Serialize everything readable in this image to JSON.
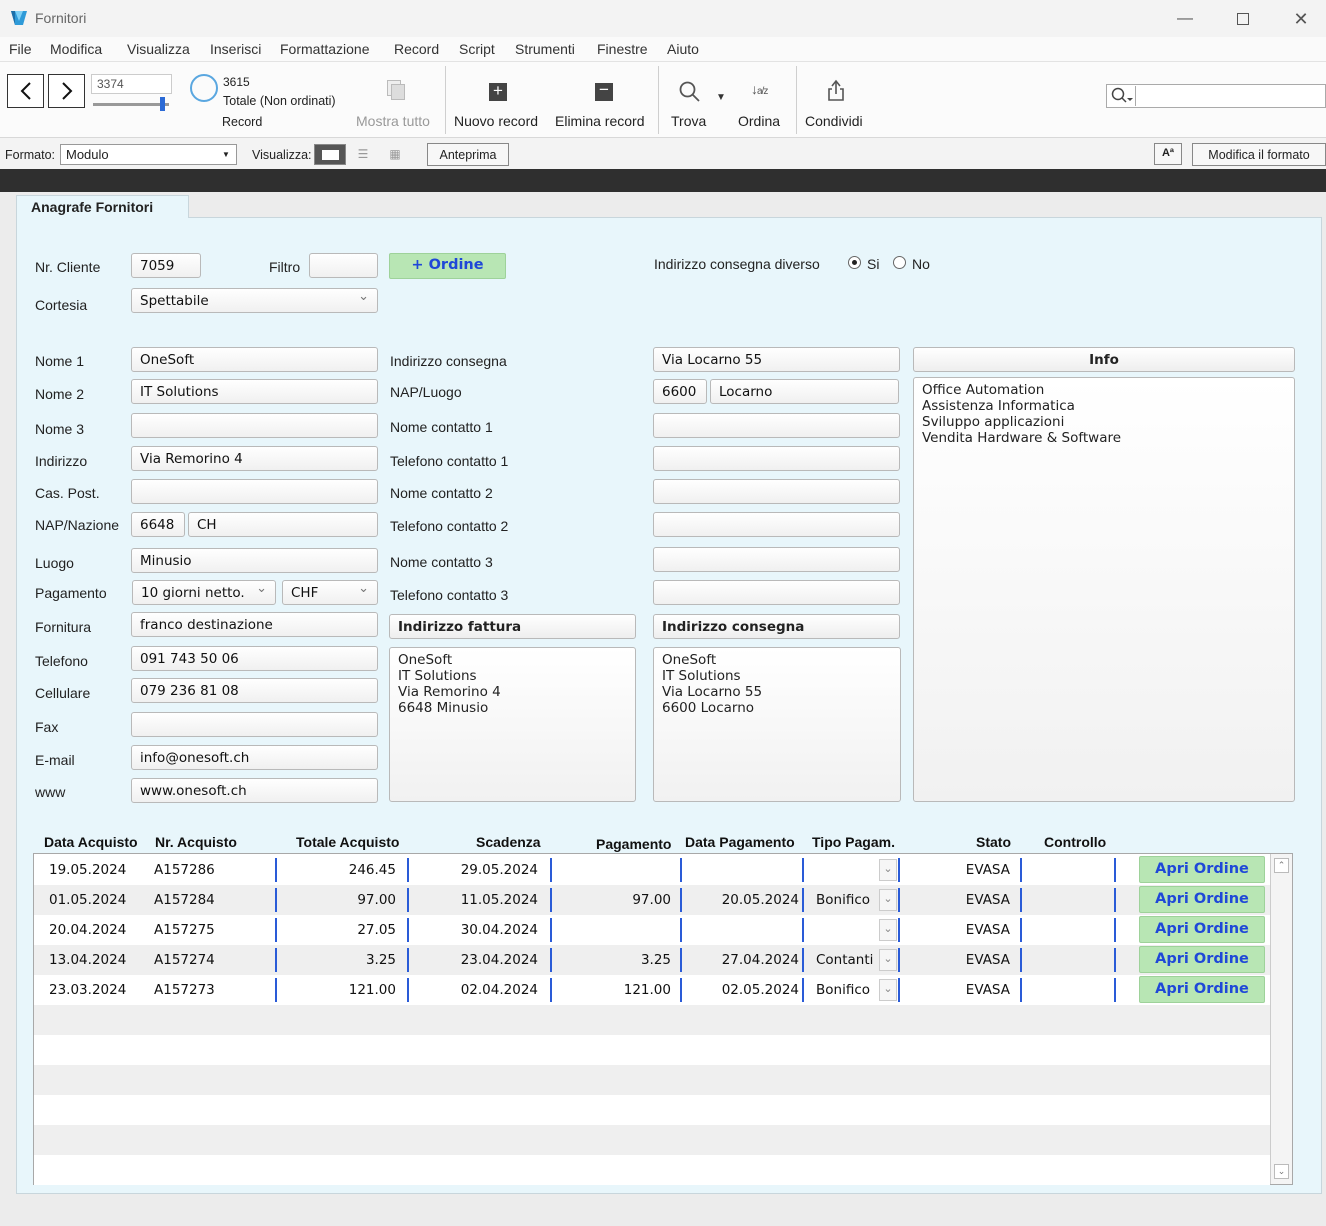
{
  "window": {
    "title": "Fornitori"
  },
  "menu": [
    "File",
    "Modifica",
    "Visualizza",
    "Inserisci",
    "Formattazione",
    "Record",
    "Script",
    "Strumenti",
    "Finestre",
    "Aiuto"
  ],
  "toolbar": {
    "record_number": "3374",
    "total_count": "3615",
    "total_label": "Totale (Non ordinati)",
    "record_label": "Record",
    "show_all": "Mostra tutto",
    "new_record": "Nuovo record",
    "delete_record": "Elimina record",
    "find": "Trova",
    "sort": "Ordina",
    "share": "Condividi",
    "search_value": ""
  },
  "formatbar": {
    "format_label": "Formato:",
    "format_value": "Modulo",
    "view_label": "Visualizza:",
    "preview": "Anteprima",
    "modify_format": "Modifica il formato"
  },
  "tab": {
    "label": "Anagrafe Fornitori"
  },
  "form": {
    "nr_cliente_label": "Nr. Cliente",
    "nr_cliente": "7059",
    "filtro_label": "Filtro",
    "filtro": "",
    "ordine_button": "+ Ordine",
    "indirizzo_diverso_label": "Indirizzo consegna diverso",
    "radio_si": "Si",
    "radio_no": "No",
    "cortesia_label": "Cortesia",
    "cortesia": "Spettabile",
    "nome1_label": "Nome 1",
    "nome1": "OneSoft",
    "nome2_label": "Nome 2",
    "nome2": "IT Solutions",
    "nome3_label": "Nome 3",
    "nome3": "",
    "indirizzo_label": "Indirizzo",
    "indirizzo": "Via Remorino 4",
    "caspost_label": "Cas. Post.",
    "caspost": "",
    "napnazione_label": "NAP/Nazione",
    "nap": "6648",
    "nazione": "CH",
    "luogo_label": "Luogo",
    "luogo": "Minusio",
    "pagamento_label": "Pagamento",
    "pagamento": "10 giorni netto.",
    "valuta": "CHF",
    "fornitura_label": "Fornitura",
    "fornitura": "franco destinazione",
    "telefono_label": "Telefono",
    "telefono": "091 743 50 06",
    "cellulare_label": "Cellulare",
    "cellulare": "079 236 81 08",
    "fax_label": "Fax",
    "fax": "",
    "email_label": "E-mail",
    "email": "info@onesoft.ch",
    "www_label": "www",
    "www": "www.onesoft.ch",
    "ind_consegna_label": "Indirizzo consegna",
    "ind_consegna": "Via Locarno 55",
    "nap_luogo_label": "NAP/Luogo",
    "nap_consegna": "6600",
    "luogo_consegna": "Locarno",
    "contatto1_label": "Nome contatto 1",
    "contatto1": "",
    "tel1_label": "Telefono contatto 1",
    "tel1": "",
    "contatto2_label": "Nome contatto 2",
    "contatto2": "",
    "tel2_label": "Telefono contatto 2",
    "tel2": "",
    "contatto3_label": "Nome contatto 3",
    "contatto3": "",
    "tel3_label": "Telefono contatto 3",
    "tel3": "",
    "fattura_header": "Indirizzo fattura",
    "fattura_text": "OneSoft\nIT Solutions\nVia Remorino 4\n6648 Minusio",
    "consegna_header": "Indirizzo consegna",
    "consegna_text": "OneSoft\nIT Solutions\nVia Locarno 55\n6600 Locarno",
    "info_header": "Info",
    "info_text": "Office Automation\nAssistenza Informatica\nSviluppo applicazioni\nVendita Hardware & Software"
  },
  "portal": {
    "headers": [
      "Data Acquisto",
      "Nr. Acquisto",
      "Totale Acquisto",
      "Scadenza",
      "Pagamento",
      "Data Pagamento",
      "Tipo Pagam.",
      "Stato",
      "Controllo"
    ],
    "open_label": "Apri Ordine",
    "rows": [
      {
        "data": "19.05.2024",
        "nr": "A157286",
        "totale": "246.45",
        "scadenza": "29.05.2024",
        "pagamento": "",
        "data_pag": "",
        "tipo": "",
        "stato": "EVASA"
      },
      {
        "data": "01.05.2024",
        "nr": "A157284",
        "totale": "97.00",
        "scadenza": "11.05.2024",
        "pagamento": "97.00",
        "data_pag": "20.05.2024",
        "tipo": "Bonifico",
        "stato": "EVASA"
      },
      {
        "data": "20.04.2024",
        "nr": "A157275",
        "totale": "27.05",
        "scadenza": "30.04.2024",
        "pagamento": "",
        "data_pag": "",
        "tipo": "",
        "stato": "EVASA"
      },
      {
        "data": "13.04.2024",
        "nr": "A157274",
        "totale": "3.25",
        "scadenza": "23.04.2024",
        "pagamento": "3.25",
        "data_pag": "27.04.2024",
        "tipo": "Contanti",
        "stato": "EVASA"
      },
      {
        "data": "23.03.2024",
        "nr": "A157273",
        "totale": "121.00",
        "scadenza": "02.04.2024",
        "pagamento": "121.00",
        "data_pag": "02.05.2024",
        "tipo": "Bonifico",
        "stato": "EVASA"
      }
    ]
  }
}
